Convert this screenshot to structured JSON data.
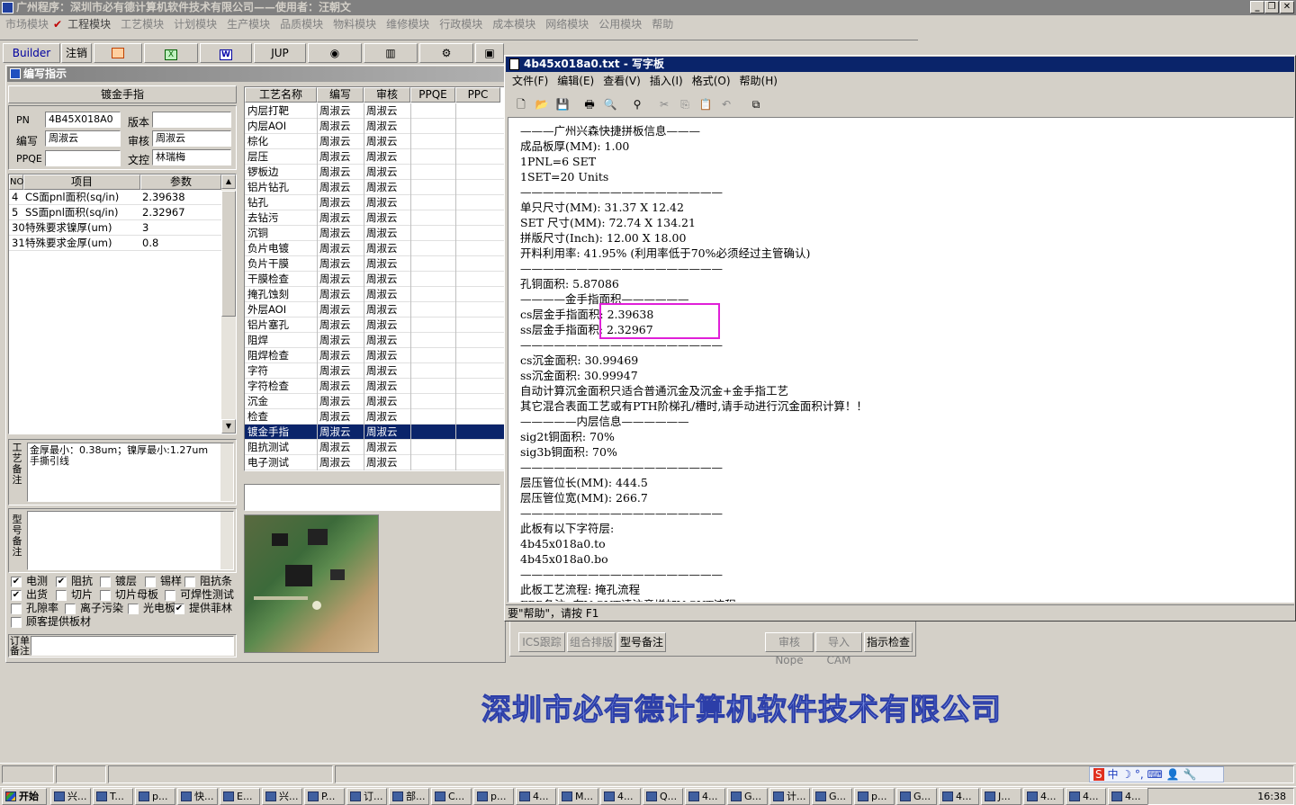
{
  "app": {
    "title": "广州程序：深圳市必有德计算机软件技术有限公司——使用者：汪朝文"
  },
  "menu": [
    "市场模块",
    "工程模块",
    "工艺模块",
    "计划模块",
    "生产模块",
    "品质模块",
    "物料模块",
    "维修模块",
    "行政模块",
    "成本模块",
    "网络模块",
    "公用模块",
    "帮助"
  ],
  "toolbar": {
    "builder": "Builder",
    "logout": "注销",
    "jup": "JUP",
    "spc": "SPC"
  },
  "editor": {
    "title": "编写指示",
    "section": "镀金手指",
    "pn_label": "PN",
    "pn_value": "4B45X018A0",
    "version_label": "版本",
    "version_value": "",
    "writer_label": "编写",
    "writer_value": "周淑云",
    "review_label": "审核",
    "review_value": "周淑云",
    "ppqe_label": "PPQE",
    "ppqe_value": "",
    "doc_label": "文控",
    "doc_value": "林瑞梅",
    "param_headers": {
      "no": "NO",
      "item": "项目",
      "param": "参数"
    },
    "params": [
      {
        "no": "4",
        "item": "CS面pnl面积(sq/in)",
        "value": "2.39638"
      },
      {
        "no": "5",
        "item": "SS面pnl面积(sq/in)",
        "value": "2.32967"
      },
      {
        "no": "30",
        "item": "特殊要求镍厚(um)",
        "value": "3"
      },
      {
        "no": "31",
        "item": "特殊要求金厚(um)",
        "value": "0.8"
      }
    ],
    "process_note_label": "工艺备注",
    "process_note": "金厚最小：0.38um；镍厚最小:1.27um\n手撕引线",
    "model_note_label": "型号备注",
    "order_note_label": "订单备注",
    "checks": [
      {
        "label": "电测",
        "checked": true
      },
      {
        "label": "阻抗",
        "checked": true
      },
      {
        "label": "镀层",
        "checked": false
      },
      {
        "label": "锡样",
        "checked": false
      },
      {
        "label": "阻抗条",
        "checked": false
      },
      {
        "label": "出货",
        "checked": true
      },
      {
        "label": "切片",
        "checked": false
      },
      {
        "label": "切片母板",
        "checked": false
      },
      {
        "label": "可焊性测试",
        "checked": false
      },
      {
        "label": "孔隙率",
        "checked": false
      },
      {
        "label": "离子污染",
        "checked": false
      },
      {
        "label": "光电板",
        "checked": false
      },
      {
        "label": "提供菲林",
        "checked": true
      },
      {
        "label": "顾客提供板材",
        "checked": false
      }
    ]
  },
  "process_table": {
    "headers": [
      "工艺名称",
      "编写",
      "审核",
      "PPQE",
      "PPC"
    ],
    "rows": [
      [
        "内层打靶",
        "周淑云",
        "周淑云"
      ],
      [
        "内层AOI",
        "周淑云",
        "周淑云"
      ],
      [
        "棕化",
        "周淑云",
        "周淑云"
      ],
      [
        "层压",
        "周淑云",
        "周淑云"
      ],
      [
        "锣板边",
        "周淑云",
        "周淑云"
      ],
      [
        "铝片钻孔",
        "周淑云",
        "周淑云"
      ],
      [
        "钻孔",
        "周淑云",
        "周淑云"
      ],
      [
        "去钻污",
        "周淑云",
        "周淑云"
      ],
      [
        "沉铜",
        "周淑云",
        "周淑云"
      ],
      [
        "负片电镀",
        "周淑云",
        "周淑云"
      ],
      [
        "负片干膜",
        "周淑云",
        "周淑云"
      ],
      [
        "干膜检查",
        "周淑云",
        "周淑云"
      ],
      [
        "掩孔蚀刻",
        "周淑云",
        "周淑云"
      ],
      [
        "外层AOI",
        "周淑云",
        "周淑云"
      ],
      [
        "铝片塞孔",
        "周淑云",
        "周淑云"
      ],
      [
        "阻焊",
        "周淑云",
        "周淑云"
      ],
      [
        "阻焊检查",
        "周淑云",
        "周淑云"
      ],
      [
        "字符",
        "周淑云",
        "周淑云"
      ],
      [
        "字符检查",
        "周淑云",
        "周淑云"
      ],
      [
        "沉金",
        "周淑云",
        "周淑云"
      ],
      [
        "检查",
        "周淑云",
        "周淑云"
      ],
      [
        "镀金手指",
        "周淑云",
        "周淑云"
      ],
      [
        "阻抗测试",
        "周淑云",
        "周淑云"
      ],
      [
        "电子测试",
        "周淑云",
        "周淑云"
      ]
    ],
    "selected_index": 21
  },
  "bottom_buttons": [
    "ICS跟踪",
    "组合排版",
    "型号备注",
    "审核Nope",
    "导入CAM",
    "指示检查"
  ],
  "wordpad": {
    "title": "4b45x018a0.txt - 写字板",
    "menu": [
      "文件(F)",
      "编辑(E)",
      "查看(V)",
      "插入(I)",
      "格式(O)",
      "帮助(H)"
    ],
    "status": "要\"帮助\"，请按 F1",
    "lines": [
      "———广州兴森快捷拼板信息———",
      "成品板厚(MM): 1.00",
      "1PNL=6 SET",
      "1SET=20 Units",
      "——————————————————",
      "单只尺寸(MM): 31.37 X 12.42",
      "SET 尺寸(MM): 72.74 X 134.21",
      "拼版尺寸(Inch): 12.00 X 18.00",
      "开料利用率: 41.95% (利用率低于70%必须经过主管确认)",
      "——————————————————",
      "孔铜面积: 5.87086",
      "————金手指面积——————",
      "cs层金手指面积: 2.39638",
      "ss层金手指面积: 2.32967",
      "——————————————————",
      "cs沉金面积: 30.99469",
      "ss沉金面积: 30.99947",
      "自动计算沉金面积只适合普通沉金及沉金+金手指工艺",
      "其它混合表面工艺或有PTH阶梯孔/槽时,请手动进行沉金面积计算！！",
      "—————内层信息——————",
      "sig2t铜面积: 70%",
      "sig3b铜面积: 70%",
      "——————————————————",
      "层压管位长(MM): 444.5",
      "层压管位宽(MM): 266.7",
      "——————————————————",
      "此板有以下字符层:",
      "4b45x018a0.to",
      "4b45x018a0.bo",
      "——————————————————",
      "此板工艺流程: 掩孔流程",
      "FPP备注: 有V-CUT请注意增加V-CUT流程"
    ]
  },
  "watermark": "深圳市必有德计算机软件技术有限公司",
  "taskbar": {
    "start": "开始",
    "tasks": [
      "兴...",
      "T...",
      "p...",
      "快...",
      "E...",
      "兴...",
      "P...",
      "订...",
      "部...",
      "C...",
      "p...",
      "4...",
      "M...",
      "4...",
      "Q...",
      "4...",
      "G...",
      "计...",
      "G...",
      "p...",
      "G...",
      "4...",
      "J...",
      "4...",
      "4...",
      "4..."
    ],
    "clock": "16:38",
    "ime": [
      "中"
    ]
  }
}
